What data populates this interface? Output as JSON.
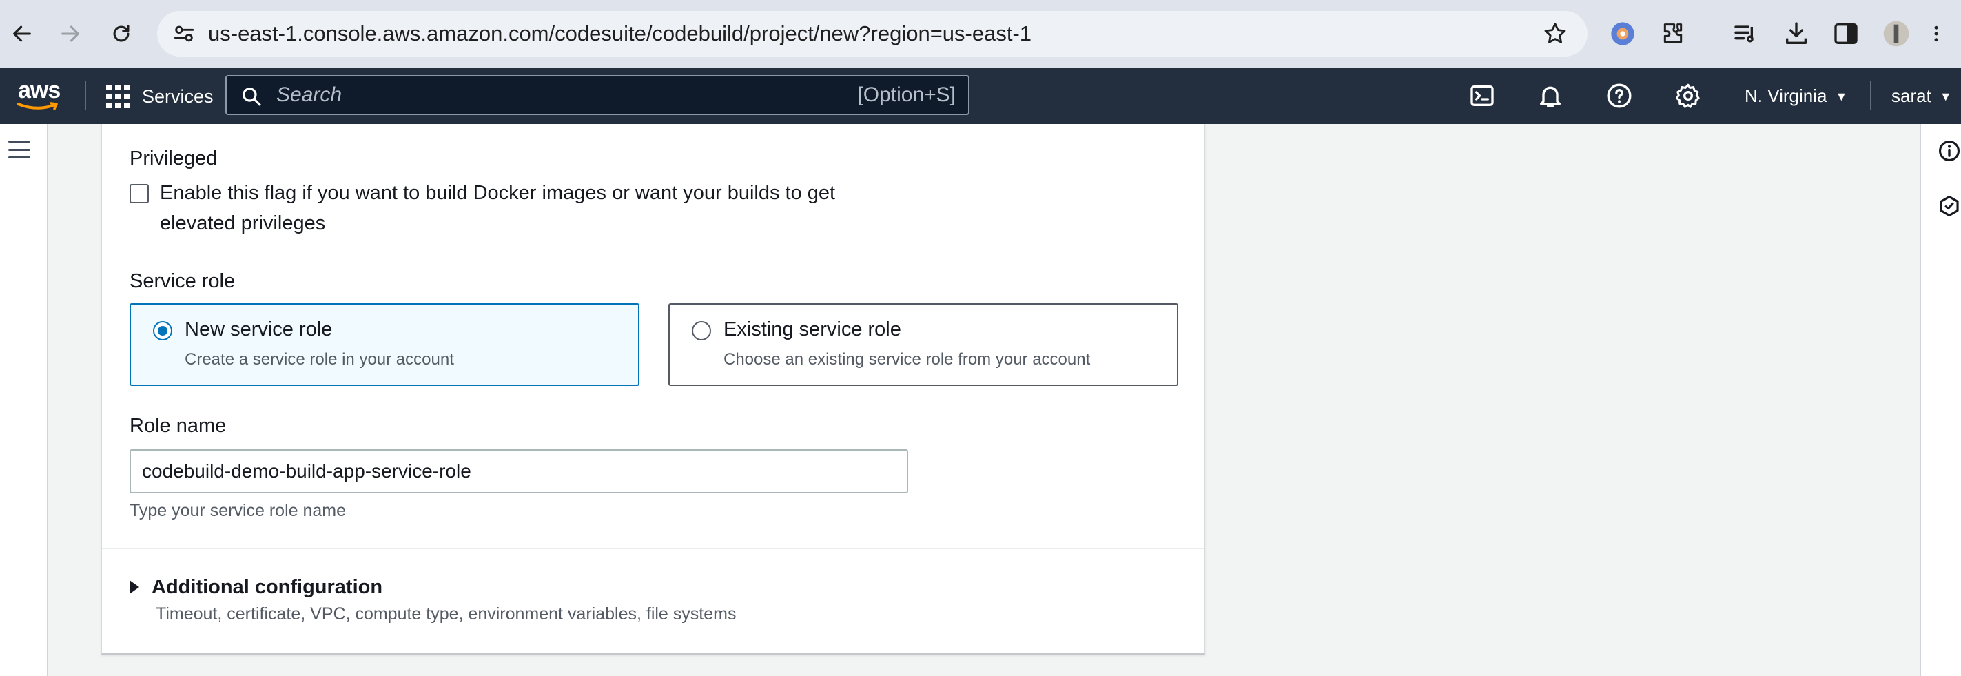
{
  "browser": {
    "url": "us-east-1.console.aws.amazon.com/codesuite/codebuild/project/new?region=us-east-1"
  },
  "aws_nav": {
    "logo_text": "aws",
    "services_label": "Services",
    "search_placeholder": "Search",
    "search_shortcut": "[Option+S]",
    "region": "N. Virginia",
    "user": "sarat"
  },
  "form": {
    "privileged": {
      "label": "Privileged",
      "checkbox_text": "Enable this flag if you want to build Docker images or want your builds to get elevated privileges",
      "checked": false
    },
    "service_role": {
      "label": "Service role",
      "options": [
        {
          "title": "New service role",
          "description": "Create a service role in your account",
          "selected": true
        },
        {
          "title": "Existing service role",
          "description": "Choose an existing service role from your account",
          "selected": false
        }
      ]
    },
    "role_name": {
      "label": "Role name",
      "value": "codebuild-demo-build-app-service-role",
      "hint": "Type your service role name"
    },
    "additional_configuration": {
      "title": "Additional configuration",
      "description": "Timeout, certificate, VPC, compute type, environment variables, file systems"
    }
  },
  "colors": {
    "aws_nav_bg": "#232f3e",
    "selected_accent": "#0073bb",
    "aws_orange": "#ff9900"
  }
}
